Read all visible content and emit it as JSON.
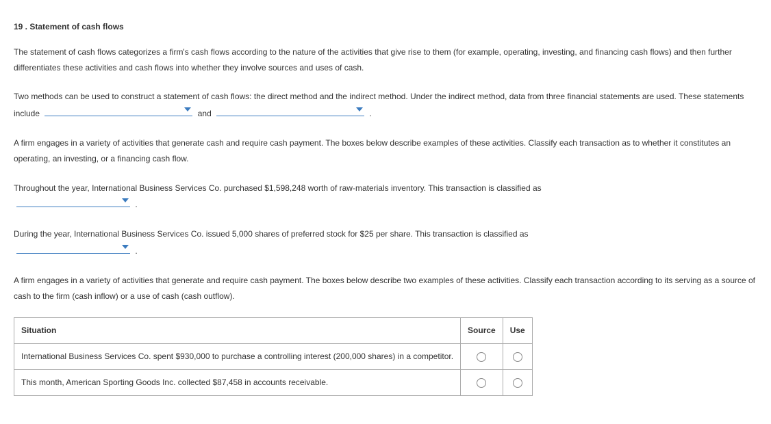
{
  "heading": "19 . Statement of cash flows",
  "para1": "The statement of cash flows categorizes a firm's cash flows according to the nature of the activities that give rise to them (for example, operating, investing, and financing cash flows) and then further differentiates these activities and cash flows into whether they involve sources and uses of cash.",
  "para2_a": "Two methods can be used to construct a statement of cash flows: the direct method and the indirect method. Under the indirect method, data from three financial statements are used. These statements include",
  "para2_and": "and",
  "para2_end": ".",
  "para3": "A firm engages in a variety of activities that generate cash and require cash payment. The boxes below describe examples of these activities. Classify each transaction as to whether it constitutes an operating, an investing, or a financing cash flow.",
  "para4_a": "Throughout the year, International Business Services Co. purchased $1,598,248 worth of raw-materials inventory. This transaction is classified as",
  "para4_end": ".",
  "para5_a": "During the year, International Business Services Co. issued 5,000 shares of preferred stock for $25 per share. This transaction is classified as",
  "para5_end": ".",
  "para6": "A firm engages in a variety of activities that generate and require cash payment. The boxes below describe two examples of these activities. Classify each transaction according to its serving as a source of cash to the firm (cash inflow) or a use of cash (cash outflow).",
  "table": {
    "col_situation": "Situation",
    "col_source": "Source",
    "col_use": "Use",
    "rows": [
      {
        "situation": "International Business Services Co. spent $930,000 to purchase a controlling interest (200,000 shares) in a competitor."
      },
      {
        "situation": "This month, American Sporting Goods Inc. collected $87,458 in accounts receivable."
      }
    ]
  }
}
